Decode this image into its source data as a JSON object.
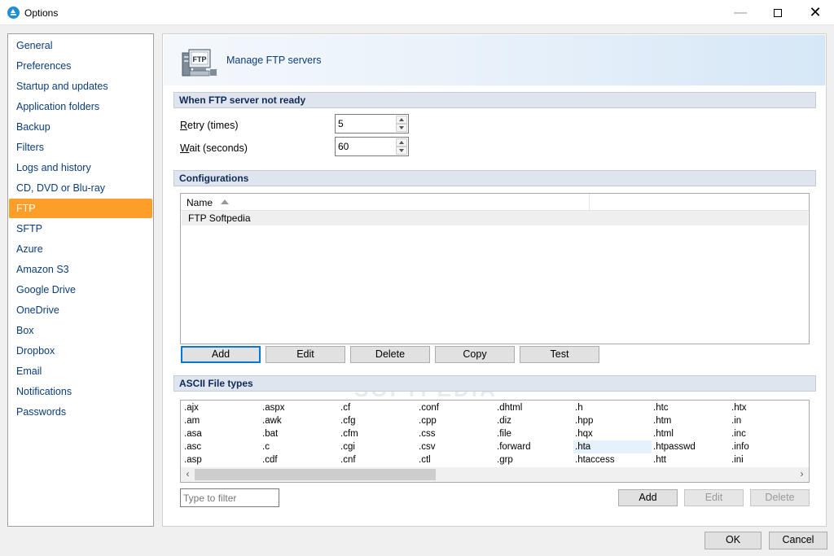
{
  "window": {
    "title": "Options",
    "minimize_label": "—",
    "close_label": "✕"
  },
  "nav": {
    "items": [
      {
        "label": "General"
      },
      {
        "label": "Preferences"
      },
      {
        "label": "Startup and updates"
      },
      {
        "label": "Application folders"
      },
      {
        "label": "Backup"
      },
      {
        "label": "Filters"
      },
      {
        "label": "Logs and history"
      },
      {
        "label": "CD, DVD or Blu-ray"
      },
      {
        "label": "FTP",
        "selected": true
      },
      {
        "label": "SFTP"
      },
      {
        "label": "Azure"
      },
      {
        "label": "Amazon S3"
      },
      {
        "label": "Google Drive"
      },
      {
        "label": "OneDrive"
      },
      {
        "label": "Box"
      },
      {
        "label": "Dropbox"
      },
      {
        "label": "Email"
      },
      {
        "label": "Notifications"
      },
      {
        "label": "Passwords"
      }
    ],
    "selected_color": "#fd9e28"
  },
  "header": {
    "icon_text": "FTP",
    "title": "Manage FTP servers"
  },
  "not_ready": {
    "section_title": "When FTP server not ready",
    "retry_label_key": "R",
    "retry_label_rest": "etry (times)",
    "retry_value": "5",
    "wait_label_key": "W",
    "wait_label_rest": "ait (seconds)",
    "wait_value": "60"
  },
  "configurations": {
    "section_title": "Configurations",
    "column_name": "Name",
    "rows": [
      "FTP Softpedia"
    ],
    "buttons": {
      "add": "Add",
      "edit": "Edit",
      "delete": "Delete",
      "copy": "Copy",
      "test": "Test"
    }
  },
  "ascii": {
    "section_title": "ASCII File types",
    "columns": [
      [
        ".ajx",
        ".am",
        ".asa",
        ".asc",
        ".asp"
      ],
      [
        ".aspx",
        ".awk",
        ".bat",
        ".c",
        ".cdf"
      ],
      [
        ".cf",
        ".cfg",
        ".cfm",
        ".cgi",
        ".cnf"
      ],
      [
        ".conf",
        ".cpp",
        ".css",
        ".csv",
        ".ctl"
      ],
      [
        ".dhtml",
        ".diz",
        ".file",
        ".forward",
        ".grp"
      ],
      [
        ".h",
        ".hpp",
        ".hqx",
        ".hta",
        ".htaccess"
      ],
      [
        ".htc",
        ".htm",
        ".html",
        ".htpasswd",
        ".htt"
      ],
      [
        ".htx",
        ".in",
        ".inc",
        ".info",
        ".ini"
      ]
    ],
    "highlighted": ".hta",
    "filter_placeholder": "Type to filter",
    "buttons": {
      "add": "Add",
      "edit": "Edit",
      "delete": "Delete"
    }
  },
  "dialog": {
    "ok": "OK",
    "cancel": "Cancel"
  },
  "watermark": "SOFTPEDIA"
}
